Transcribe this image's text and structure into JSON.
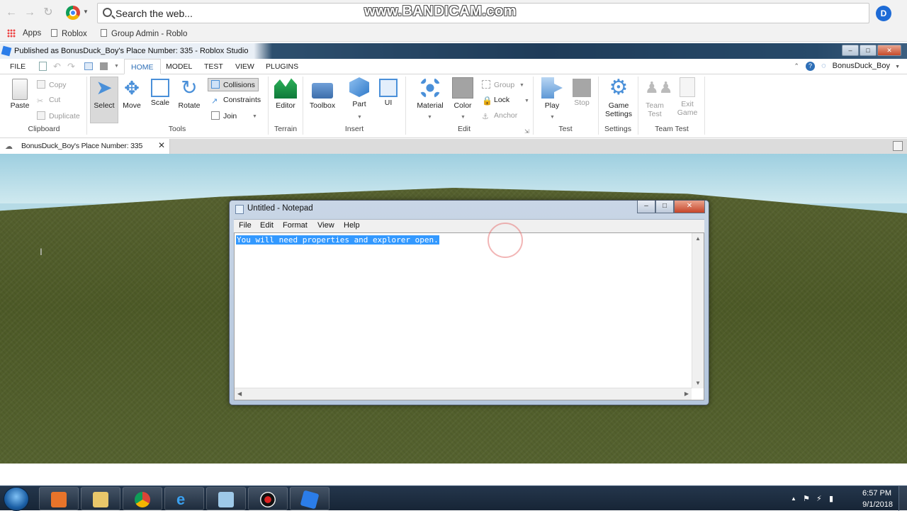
{
  "browser": {
    "omnibox_text": "Search the web...",
    "watermark": "www.BANDICAM.com",
    "profile_letter": "D",
    "bookmarks": {
      "apps": "Apps",
      "item1": "Roblox",
      "item2": "Group Admin - Roblo"
    }
  },
  "studio": {
    "title": "Published as BonusDuck_Boy's Place Number: 335 - Roblox Studio",
    "tabs": [
      "FILE",
      "HOME",
      "MODEL",
      "TEST",
      "VIEW",
      "PLUGINS"
    ],
    "username": "BonusDuck_Boy",
    "ribbon": {
      "clipboard": {
        "paste": "Paste",
        "copy": "Copy",
        "cut": "Cut",
        "duplicate": "Duplicate",
        "label": "Clipboard"
      },
      "tools": {
        "select": "Select",
        "move": "Move",
        "scale": "Scale",
        "rotate": "Rotate",
        "collisions": "Collisions",
        "constraints": "Constraints",
        "join": "Join",
        "label": "Tools"
      },
      "terrain": {
        "editor": "Editor",
        "label": "Terrain"
      },
      "insert": {
        "toolbox": "Toolbox",
        "part": "Part",
        "ui": "UI",
        "label": "Insert"
      },
      "edit": {
        "material": "Material",
        "color": "Color",
        "group": "Group",
        "lock": "Lock",
        "anchor": "Anchor",
        "label": "Edit"
      },
      "test": {
        "play": "Play",
        "stop": "Stop",
        "label": "Test"
      },
      "settings": {
        "game_settings_line1": "Game",
        "game_settings_line2": "Settings",
        "label": "Settings"
      },
      "team_test": {
        "team_test_line1": "Team",
        "team_test_line2": "Test",
        "exit_game_line1": "Exit",
        "exit_game_line2": "Game",
        "label": "Team Test"
      }
    },
    "doc_tab": "BonusDuck_Boy's Place Number: 335"
  },
  "notepad": {
    "title": "Untitled - Notepad",
    "menu": [
      "File",
      "Edit",
      "Format",
      "View",
      "Help"
    ],
    "selected_text": "You will need properties and explorer open."
  },
  "taskbar": {
    "time": "6:57 PM",
    "date": "9/1/2018"
  },
  "colors": {
    "accent_blue": "#2e6fb7",
    "selection": "#3399ff",
    "grass": "#56612f",
    "sky": "#b6dbe6"
  }
}
